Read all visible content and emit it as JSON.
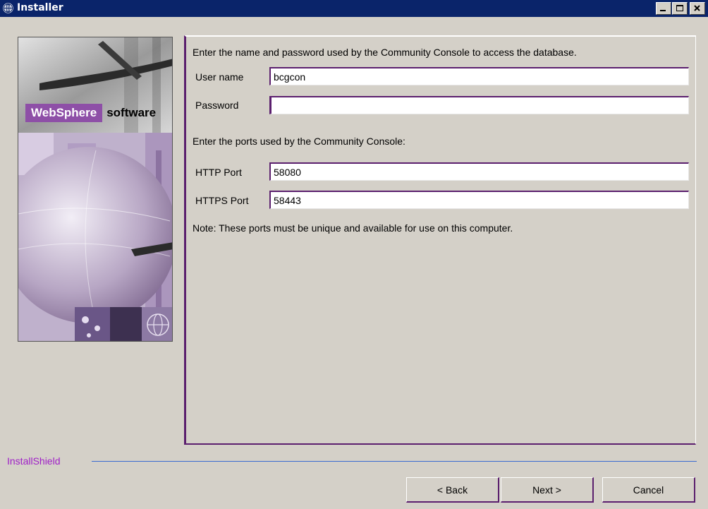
{
  "window": {
    "title": "Installer",
    "icon": "globe-icon",
    "controls": [
      "minimize-icon",
      "maximize-icon",
      "close-icon"
    ]
  },
  "banner": {
    "brand": "WebSphere",
    "brand_suffix": "software",
    "accent_color": "#8e4fa7"
  },
  "form": {
    "db_instruction": "Enter the name and password used by the Community Console to access the database.",
    "username_label": "User name",
    "username_value": "bcgcon",
    "password_label": "Password",
    "password_value": "",
    "ports_instruction": "Enter the ports used by the Community Console:",
    "http_label": "HTTP Port",
    "http_value": "58080",
    "https_label": "HTTPS Port",
    "https_value": "58443",
    "note": "Note: These ports must be unique and available for use on this computer."
  },
  "footer": {
    "brand": "InstallShield",
    "back_label": "< Back",
    "next_label": "Next >",
    "cancel_label": "Cancel"
  }
}
